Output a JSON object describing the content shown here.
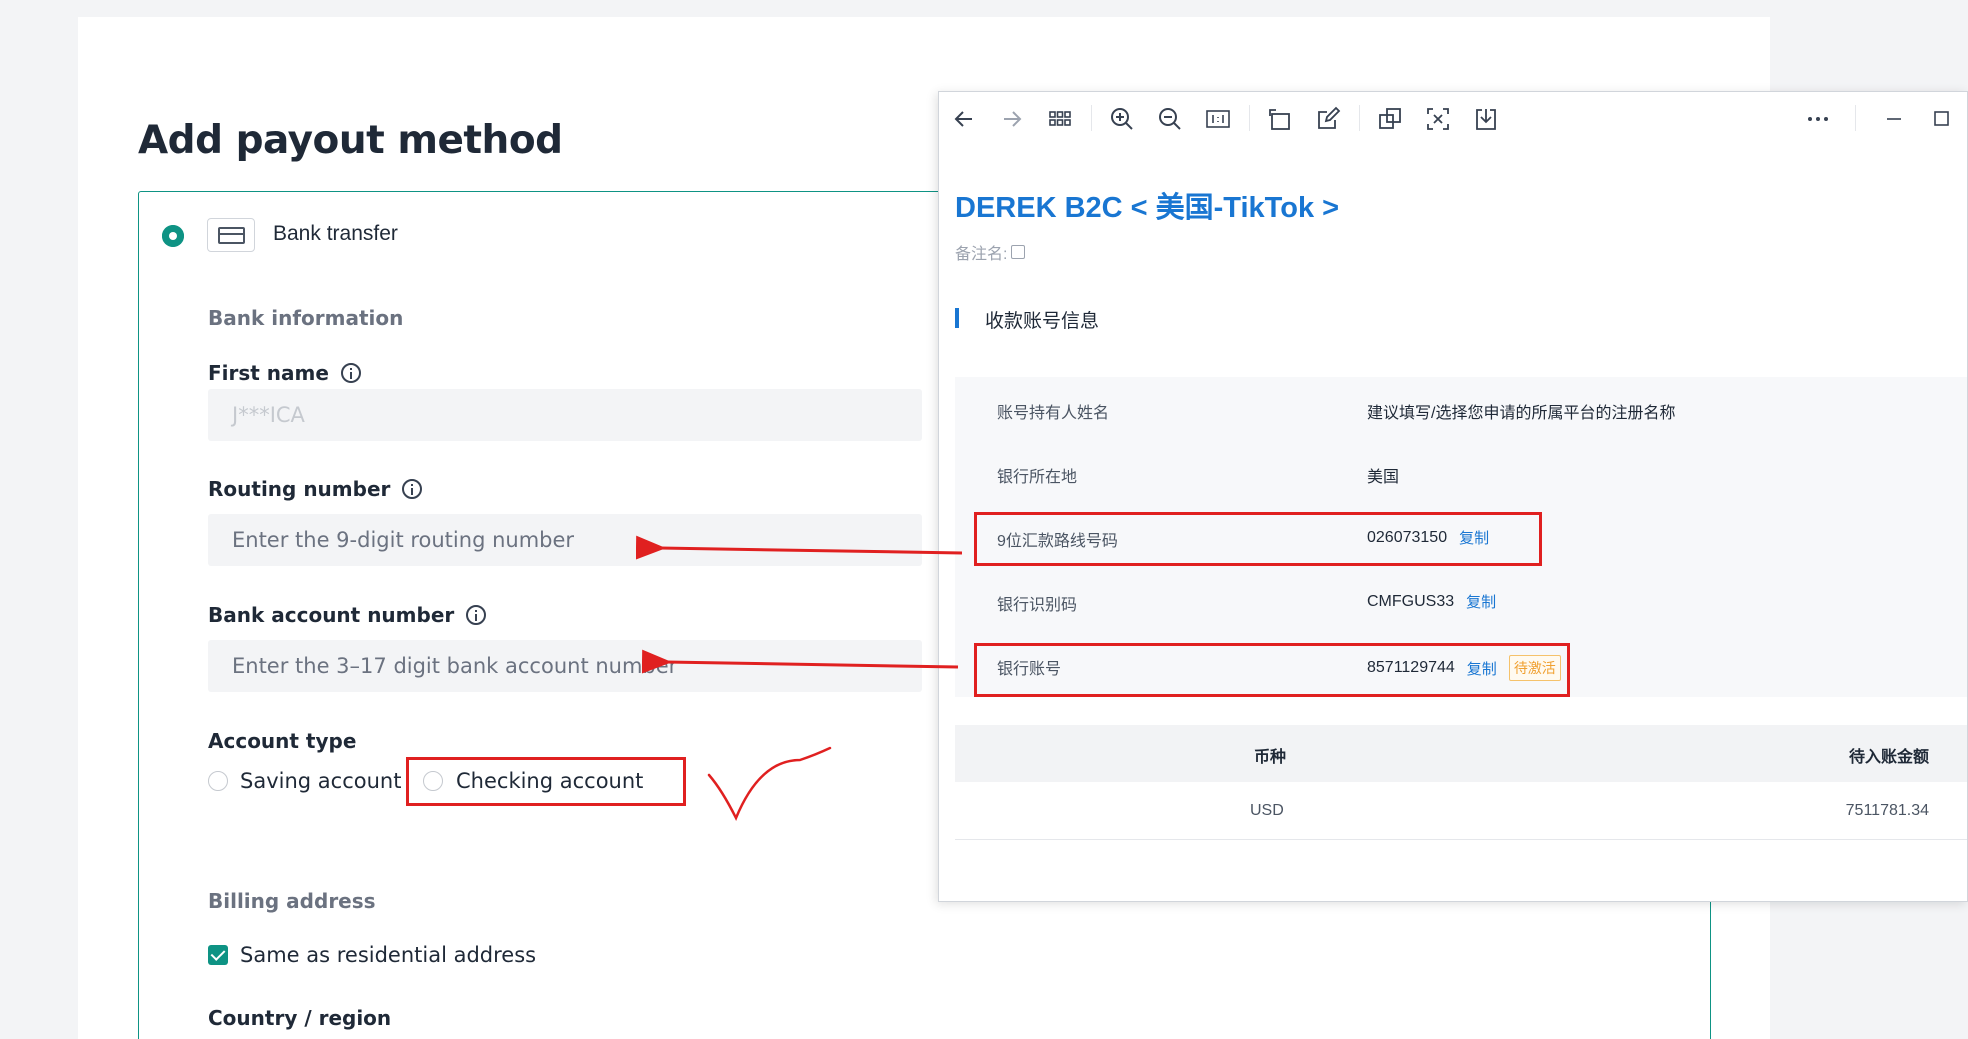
{
  "form": {
    "title": "Add payout method",
    "method_label": "Bank transfer",
    "bank_info_heading": "Bank information",
    "first_name_label": "First name",
    "first_name_value": "J***ICA",
    "routing_label": "Routing number",
    "routing_placeholder": "Enter the 9-digit routing number",
    "account_label": "Bank account number",
    "account_placeholder": "Enter the 3–17 digit bank account number",
    "account_type_label": "Account type",
    "saving_option": "Saving account",
    "checking_option": "Checking account",
    "billing_heading": "Billing address",
    "same_address_label": "Same as residential address",
    "country_label": "Country / region"
  },
  "viewer": {
    "toolbar_icons": [
      "back-arrow-icon",
      "forward-arrow-icon",
      "grid-icon",
      "zoom-in-icon",
      "zoom-out-icon",
      "actual-size-icon",
      "rotate-icon",
      "edit-icon",
      "copy-icon",
      "scan-text-icon",
      "download-icon",
      "more-icon",
      "minimize-icon",
      "maximize-icon"
    ],
    "title": "DEREK B2C < 美国-TikTok >",
    "remark_label": "备注名:",
    "section_title": "收款账号信息",
    "rows": [
      {
        "key": "账号持有人姓名",
        "value": "建议填写/选择您申请的所属平台的注册名称"
      },
      {
        "key": "银行所在地",
        "value": "美国"
      },
      {
        "key": "9位汇款路线号码",
        "value": "026073150",
        "copy": "复制"
      },
      {
        "key": "银行识别码",
        "value": "CMFGUS33",
        "copy": "复制"
      },
      {
        "key": "银行账号",
        "value": "8571129744",
        "copy": "复制",
        "badge": "待激活"
      }
    ],
    "currency_header": "币种",
    "amount_header": "待入账金额",
    "currency_value": "USD",
    "amount_value": "7511781.34"
  },
  "colors": {
    "accent_teal": "#0e9384",
    "viewer_blue": "#1976d2",
    "annotation_red": "#e02020"
  }
}
